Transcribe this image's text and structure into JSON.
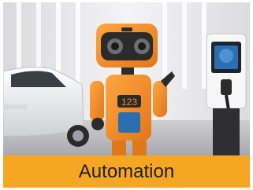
{
  "card": {
    "caption": "Automation",
    "caption_bg": "#f5a623",
    "image_subject": "robot-illustration"
  },
  "colors": {
    "robot_orange": "#f08a24",
    "robot_dark": "#2b2b2b",
    "car_white": "#f2f2f2",
    "charger_screen": "#2c6fb0",
    "wall": "#e8e8ea"
  }
}
